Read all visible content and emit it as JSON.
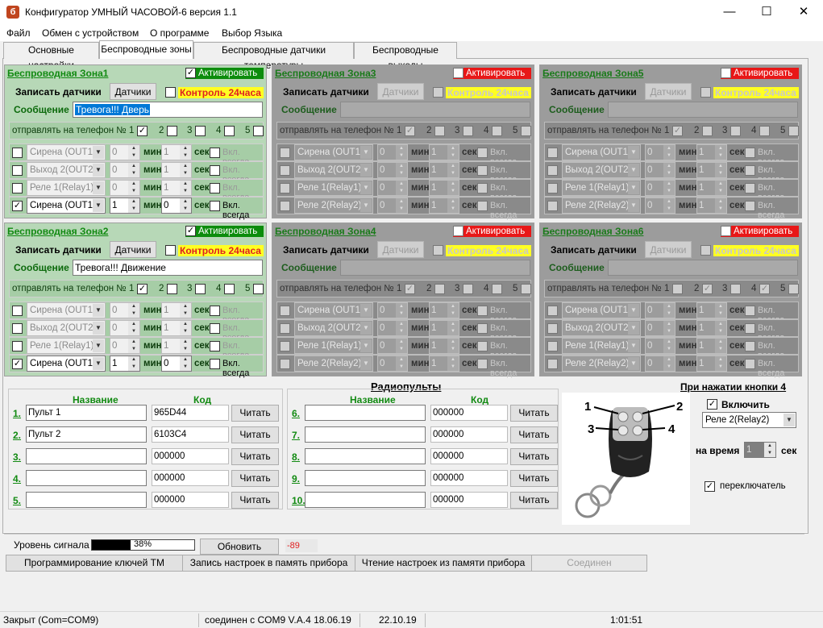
{
  "window": {
    "title": "Конфигуратор УМНЫЙ ЧАСОВОЙ-6 версия 1.1",
    "icon_letter": "б",
    "minimize": "—",
    "maximize": "☐",
    "close": "✕"
  },
  "menu": [
    "Файл",
    "Обмен с устройством",
    "О программе",
    "Выбор Языка"
  ],
  "tabs": [
    "Основные настройки",
    "Беспроводные зоны",
    "Беспроводные датчики температуры",
    "Беспроводные выходы"
  ],
  "active_tab": 1,
  "zone_labels": {
    "activate": "Активировать",
    "record_sensors": "Записать датчики",
    "sensors_btn": "Датчики",
    "control24": "Контроль 24часа",
    "message": "Сообщение",
    "send_to_phone": "отправлять на телефон №",
    "min": "мин",
    "sec": "сек",
    "always_on": "Вкл. всегда"
  },
  "zones": [
    {
      "title": "Беспроводная Зона1",
      "active": true,
      "activated": true,
      "control24": false,
      "message": "Тревога!!! Дверь",
      "message_selected": true,
      "phones": [
        true,
        false,
        false,
        false,
        false
      ],
      "outputs": [
        {
          "checked": false,
          "name": "Сирена (OUT1",
          "min": "0",
          "sec": "1",
          "always": false,
          "enabled": false
        },
        {
          "checked": false,
          "name": "Выход 2(OUT2",
          "min": "0",
          "sec": "1",
          "always": false,
          "enabled": false
        },
        {
          "checked": false,
          "name": "Реле 1(Relay1)",
          "min": "0",
          "sec": "1",
          "always": false,
          "enabled": false
        },
        {
          "checked": true,
          "name": "Сирена (OUT1",
          "min": "1",
          "sec": "0",
          "always": false,
          "enabled": true
        }
      ]
    },
    {
      "title": "Беспроводная Зона3",
      "active": false,
      "activated": false,
      "control24": false,
      "message": "",
      "message_selected": false,
      "phones": [
        true,
        false,
        false,
        false,
        false
      ],
      "outputs": [
        {
          "checked": false,
          "name": "Сирена (OUT1",
          "min": "0",
          "sec": "1",
          "always": false,
          "enabled": false
        },
        {
          "checked": false,
          "name": "Выход 2(OUT2",
          "min": "0",
          "sec": "1",
          "always": false,
          "enabled": false
        },
        {
          "checked": false,
          "name": "Реле 1(Relay1)",
          "min": "0",
          "sec": "1",
          "always": false,
          "enabled": false
        },
        {
          "checked": false,
          "name": "Реле 2(Relay2)",
          "min": "0",
          "sec": "1",
          "always": false,
          "enabled": false
        }
      ]
    },
    {
      "title": "Беспроводная Зона5",
      "active": false,
      "activated": false,
      "control24": false,
      "message": "",
      "message_selected": false,
      "phones": [
        true,
        false,
        false,
        false,
        false
      ],
      "outputs": [
        {
          "checked": false,
          "name": "Сирена (OUT1",
          "min": "0",
          "sec": "1",
          "always": false,
          "enabled": false
        },
        {
          "checked": false,
          "name": "Выход 2(OUT2",
          "min": "0",
          "sec": "1",
          "always": false,
          "enabled": false
        },
        {
          "checked": false,
          "name": "Реле 1(Relay1)",
          "min": "0",
          "sec": "1",
          "always": false,
          "enabled": false
        },
        {
          "checked": false,
          "name": "Реле 2(Relay2)",
          "min": "0",
          "sec": "1",
          "always": false,
          "enabled": false
        }
      ]
    },
    {
      "title": "Беспроводная Зона2",
      "active": true,
      "activated": true,
      "control24": false,
      "message": "Тревога!!! Движение",
      "message_selected": false,
      "phones": [
        true,
        false,
        false,
        false,
        false
      ],
      "outputs": [
        {
          "checked": false,
          "name": "Сирена (OUT1",
          "min": "0",
          "sec": "1",
          "always": false,
          "enabled": false
        },
        {
          "checked": false,
          "name": "Выход 2(OUT2",
          "min": "0",
          "sec": "1",
          "always": false,
          "enabled": false
        },
        {
          "checked": false,
          "name": "Реле 1(Relay1)",
          "min": "0",
          "sec": "1",
          "always": false,
          "enabled": false
        },
        {
          "checked": true,
          "name": "Сирена (OUT1",
          "min": "1",
          "sec": "0",
          "always": false,
          "enabled": true
        }
      ]
    },
    {
      "title": "Беспроводная Зона4",
      "active": false,
      "activated": false,
      "control24": false,
      "message": "",
      "message_selected": false,
      "phones": [
        true,
        false,
        false,
        false,
        false
      ],
      "outputs": [
        {
          "checked": false,
          "name": "Сирена (OUT1",
          "min": "0",
          "sec": "1",
          "always": false,
          "enabled": false
        },
        {
          "checked": false,
          "name": "Выход 2(OUT2",
          "min": "0",
          "sec": "1",
          "always": false,
          "enabled": false
        },
        {
          "checked": false,
          "name": "Реле 1(Relay1)",
          "min": "0",
          "sec": "1",
          "always": false,
          "enabled": false
        },
        {
          "checked": false,
          "name": "Реле 2(Relay2)",
          "min": "0",
          "sec": "1",
          "always": false,
          "enabled": false
        }
      ]
    },
    {
      "title": "Беспроводная Зона6",
      "active": false,
      "activated": false,
      "control24": false,
      "message": "",
      "message_selected": false,
      "phones": [
        false,
        true,
        false,
        true,
        false
      ],
      "outputs": [
        {
          "checked": false,
          "name": "Сирена (OUT1",
          "min": "0",
          "sec": "1",
          "always": false,
          "enabled": false
        },
        {
          "checked": false,
          "name": "Выход 2(OUT2",
          "min": "0",
          "sec": "1",
          "always": false,
          "enabled": false
        },
        {
          "checked": false,
          "name": "Реле 1(Relay1)",
          "min": "0",
          "sec": "1",
          "always": false,
          "enabled": false
        },
        {
          "checked": false,
          "name": "Реле 2(Relay2)",
          "min": "0",
          "sec": "1",
          "always": false,
          "enabled": false
        }
      ]
    }
  ],
  "remotes": {
    "title": "Радиопульты",
    "name_header": "Название",
    "code_header": "Код",
    "read_label": "Читать",
    "items": [
      {
        "num": "1.",
        "name": "Пульт 1",
        "code": "965D44"
      },
      {
        "num": "2.",
        "name": "Пульт 2",
        "code": "6103C4"
      },
      {
        "num": "3.",
        "name": "",
        "code": "000000"
      },
      {
        "num": "4.",
        "name": "",
        "code": "000000"
      },
      {
        "num": "5.",
        "name": "",
        "code": "000000"
      },
      {
        "num": "6.",
        "name": "",
        "code": "000000"
      },
      {
        "num": "7.",
        "name": "",
        "code": "000000"
      },
      {
        "num": "8.",
        "name": "",
        "code": "000000"
      },
      {
        "num": "9.",
        "name": "",
        "code": "000000"
      },
      {
        "num": "10.",
        "name": "",
        "code": "000000"
      }
    ]
  },
  "keyfob": {
    "labels": [
      "1",
      "2",
      "3",
      "4"
    ]
  },
  "button_action": {
    "title": "При нажатии кнопки 4",
    "enable_label": "Включить",
    "enabled": true,
    "output": "Реле 2(Relay2)",
    "time_label": "на время",
    "time_value": "1",
    "time_unit": "сек",
    "toggle_label": "переключатель",
    "toggle": true
  },
  "signal": {
    "label": "Уровень сигнала",
    "percent_text": "38%",
    "percent": 38,
    "refresh_label": "Обновить",
    "dbm": "-89 dBm"
  },
  "actions": {
    "program_keys": "Программирование ключей ТМ",
    "write_settings": "Запись настроек в память прибора",
    "read_settings": "Чтение настроек из памяти прибора",
    "connect": "Соединен"
  },
  "status": {
    "port": "Закрыт (Com=COM9)",
    "connection": "соединен с COM9  V.A.4 18.06.19",
    "date": "22.10.19",
    "time": "1:01:51"
  }
}
